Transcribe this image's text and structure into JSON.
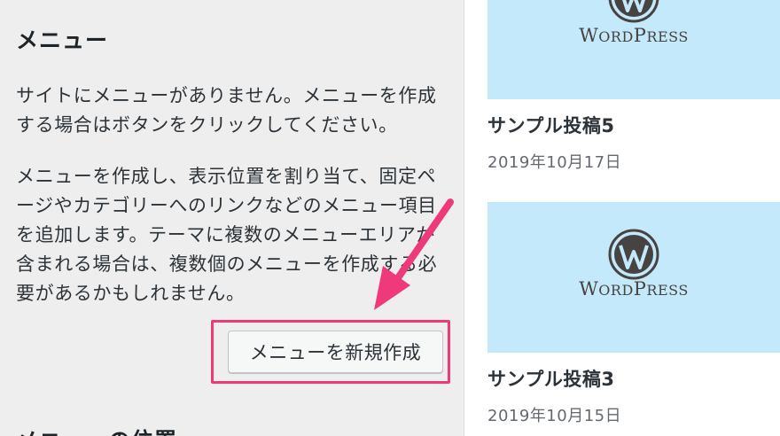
{
  "menu_panel": {
    "title": "メニュー",
    "no_menu_text": "サイトにメニューがありません。メニューを作成する場合はボタンをクリックしてください。",
    "description": "メニューを作成し、表示位置を割り当て、固定ページやカテゴリーへのリンクなどのメニュー項目を追加します。テーマに複数のメニューエリアが含まれる場合は、複数個のメニューを作成する必要があるかもしれません。",
    "create_button_label": "メニューを新規作成",
    "next_section_title": "メニューの位置"
  },
  "posts": [
    {
      "thumbnail_wordmark": "WordPress",
      "title": "サンプル投稿5",
      "date": "2019年10月17日"
    },
    {
      "thumbnail_wordmark": "WordPress",
      "title": "サンプル投稿3",
      "date": "2019年10月15日"
    }
  ],
  "colors": {
    "panel_background": "#eeeeee",
    "highlight": "#ee3a7a",
    "thumbnail_background": "#c4e9fa",
    "wordpress_logo": "#464342"
  },
  "icons": {
    "logo": "wordpress-logo-icon",
    "pointer": "arrow-icon"
  }
}
